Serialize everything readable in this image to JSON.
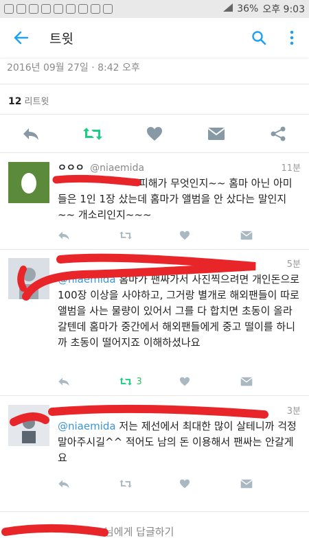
{
  "status_bar": {
    "battery": "36%",
    "time": "오후 9:03"
  },
  "app_bar": {
    "title": "트윗"
  },
  "tweet": {
    "datetime": "2016년 09월 27일 · 8:42 오후",
    "retweet_count": "12",
    "retweet_label": "리트윗"
  },
  "replies": [
    {
      "name": "ㅇㅇㅇ",
      "handle": "@niaemida",
      "time": "11분",
      "text": "피해가 무엇인지~~ 홈마 아닌 아미들은 1인 1장 샀는데 홈마가 앨범을 안 샀다는 말인지~~ 개소리인지~~~"
    },
    {
      "name": "",
      "handle": "",
      "time": "5분",
      "mention": "@niaemida",
      "text": " 홈마가 팬싸가서 사진찍으려면 개인돈으로 100장 이상을 사야하고, 그거랑 별개로 해외팬들이 따로 앨범을 사는 물량이 있어서 그를 다 합치면 초동이 올라갈텐데 홈마가 중간에서 해외팬들에게 중고 떨이를 하니까 초동이 떨어지죠 이해하셨나요",
      "retweets": "3"
    },
    {
      "name": "",
      "handle": "",
      "time": "3분",
      "mention": "@niaemida",
      "text": " 저는 제선에서 최대한 많이 살테니까 걱정 말아주시길^^ 적어도 남의 돈 이용해서 팬싸는 안갈게요"
    }
  ],
  "compose": {
    "placeholder": "님에게 답글하기"
  },
  "colors": {
    "accent": "#1da1f2",
    "retweet_green": "#2fbe60",
    "redaction": "#e8262a"
  }
}
